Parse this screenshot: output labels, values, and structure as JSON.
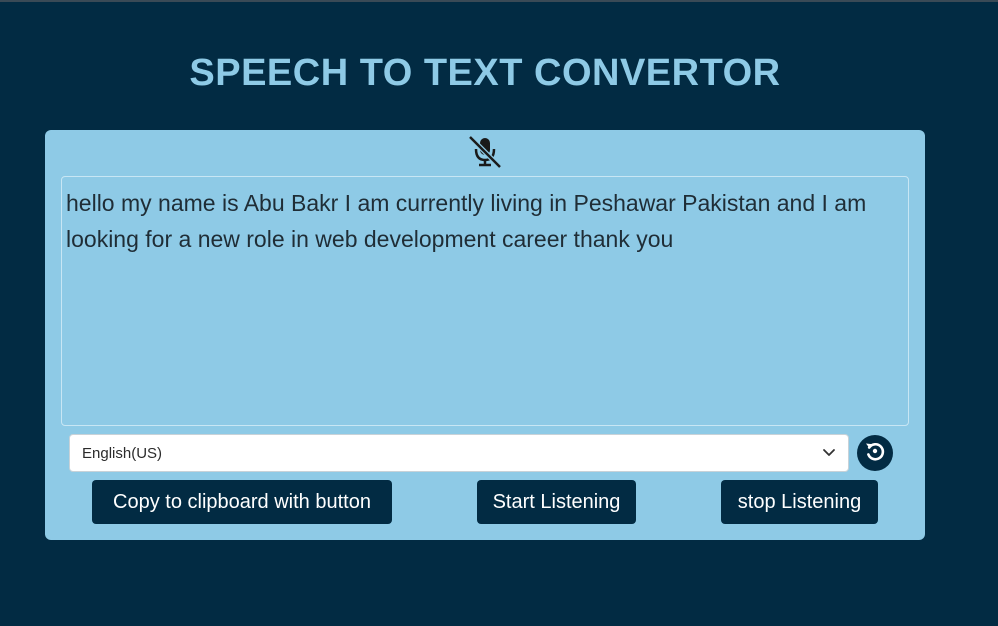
{
  "header": {
    "title": "SPEECH TO TEXT CONVERTOR"
  },
  "mic": {
    "icon": "microphone-slash-icon",
    "state": "muted"
  },
  "transcript": {
    "value": "hello my name is Abu Bakr I am currently living in Peshawar Pakistan and I am looking for a new role in web development career thank you"
  },
  "language": {
    "selected": "English(US)",
    "icon": "chevron-down-icon"
  },
  "reset": {
    "icon": "reset-icon"
  },
  "buttons": {
    "copy_label": "Copy to clipboard with button",
    "start_label": "Start Listening",
    "stop_label": "stop Listening"
  },
  "colors": {
    "background": "#022b43",
    "card": "#8ecae6",
    "title": "#8ecae6",
    "button": "#022b43",
    "button_text": "#ffffff"
  }
}
